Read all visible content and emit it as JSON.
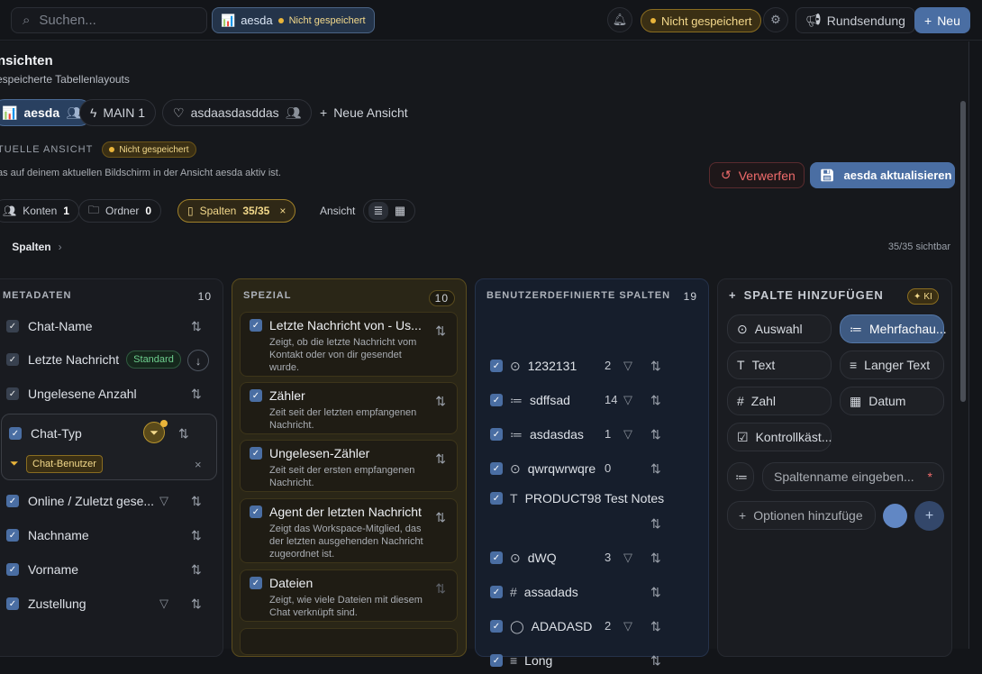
{
  "top": {
    "search_placeholder": "Suchen...",
    "view_name": "aesda",
    "view_status": "Nicht gespeichert",
    "unsaved": "Nicht gespeichert",
    "broadcast": "Rundsendung",
    "new": "Neu"
  },
  "header": {
    "title": "nsichten",
    "subtitle": "espeicherte Tabellenlayouts"
  },
  "tabs": [
    "aesda",
    "MAIN 1",
    "asdaasdasddas",
    "Neue Ansicht"
  ],
  "current": {
    "label": "TUELLE ANSICHT",
    "status": "Nicht gespeichert",
    "desc": "as auf deinem aktuellen Bildschirm in der Ansicht aesda aktiv ist.",
    "discard": "Verwerfen",
    "update": "aesda aktualisieren"
  },
  "chips": {
    "konten": "Konten",
    "konten_n": "1",
    "ordner": "Ordner",
    "ordner_n": "0",
    "spalten": "Spalten",
    "spalten_n": "35/35",
    "ansicht": "Ansicht"
  },
  "crumb": {
    "label": "Spalten",
    "visible": "35/35 sichtbar"
  },
  "meta": {
    "title": "METADATEN",
    "count": "10",
    "items": [
      "Chat-Name",
      "Letzte Nachricht",
      "Ungelesene Anzahl",
      "Chat-Typ",
      "Online / Zuletzt gese...",
      "Nachname",
      "Vorname",
      "Zustellung"
    ],
    "standard": "Standard",
    "filter_tag": "Chat-Benutzer"
  },
  "spezial": {
    "title": "SPEZIAL",
    "count": "10",
    "items": [
      {
        "t": "Letzte Nachricht von - Us...",
        "d": "Zeigt, ob die letzte Nachricht vom Kontakt oder von dir gesendet wurde."
      },
      {
        "t": "Zähler",
        "d": "Zeit seit der letzten empfangenen Nachricht."
      },
      {
        "t": "Ungelesen-Zähler",
        "d": "Zeit seit der ersten empfangenen Nachricht."
      },
      {
        "t": "Agent der letzten Nachricht",
        "d": "Zeigt das Workspace-Mitglied, das der letzten ausgehenden Nachricht zugeordnet ist."
      },
      {
        "t": "Dateien",
        "d": "Zeigt, wie viele Dateien mit diesem Chat verknüpft sind."
      }
    ]
  },
  "custom": {
    "title": "BENUTZERDEFINIERTE SPALTEN",
    "count": "19",
    "items": [
      {
        "name": "1232131",
        "n": "2"
      },
      {
        "name": "sdffsad",
        "n": "14"
      },
      {
        "name": "asdasdas",
        "n": "1"
      },
      {
        "name": "qwrqwrwqre",
        "n": "0"
      },
      {
        "name": "PRODUCT98 Test Notes",
        "n": ""
      },
      {
        "name": "dWQ",
        "n": "3"
      },
      {
        "name": "assadads",
        "n": ""
      },
      {
        "name": "ADADASD",
        "n": "2"
      },
      {
        "name": "Long",
        "n": ""
      }
    ]
  },
  "add": {
    "title": "SPALTE HINZUFÜGEN",
    "ki": "KI",
    "types": [
      "Auswahl",
      "Mehrfachau...",
      "Text",
      "Langer Text",
      "Zahl",
      "Datum",
      "Kontrollkäst..."
    ],
    "name_placeholder": "Spaltenname eingeben...",
    "options": "Optionen hinzufüge"
  }
}
